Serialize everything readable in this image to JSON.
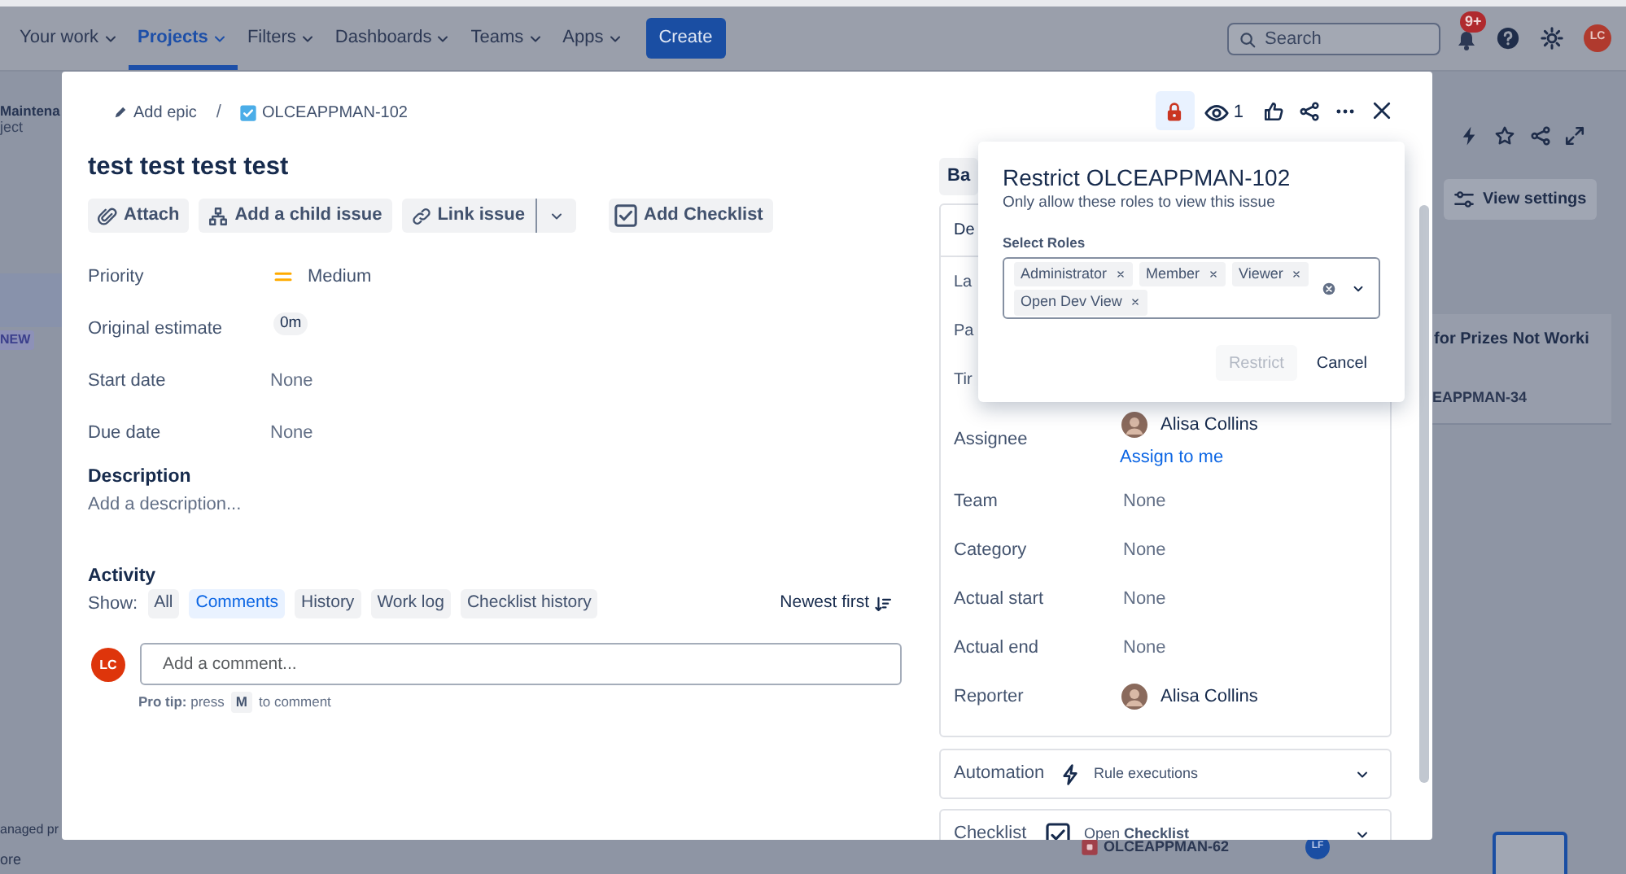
{
  "nav": {
    "items": [
      {
        "label": "Your work",
        "selected": false
      },
      {
        "label": "Projects",
        "selected": true
      },
      {
        "label": "Filters",
        "selected": false
      },
      {
        "label": "Dashboards",
        "selected": false
      },
      {
        "label": "Teams",
        "selected": false
      },
      {
        "label": "Apps",
        "selected": false
      }
    ],
    "create": "Create",
    "search_placeholder": "Search",
    "notifications": "9+",
    "avatar": "LC"
  },
  "background": {
    "project_name": "Maintena",
    "project_type": "ject",
    "tag": "NEW",
    "sidebar_footer": [
      "anaged pr",
      "ore"
    ],
    "view_settings": "View settings",
    "card_title": "for Prizes Not Worki",
    "card_key": "EAPPMAN-34",
    "bottom_card_key": "OLCEAPPMAN-62",
    "bottom_card_avatar": "LF"
  },
  "issue": {
    "breadcrumb": {
      "epic": "Add epic",
      "separator": "/",
      "key": "OLCEAPPMAN-102"
    },
    "restricted": true,
    "watchers": "1",
    "title": "test test test test",
    "actions": [
      {
        "label": "Attach",
        "kind": "attach",
        "split": false
      },
      {
        "label": "Add a child issue",
        "kind": "child",
        "split": false
      },
      {
        "label": "Link issue",
        "kind": "link",
        "split": true
      },
      {
        "label": "Add Checklist",
        "kind": "checklist",
        "split": false
      }
    ],
    "fields": [
      {
        "label": "Priority",
        "value": "Medium",
        "kind": "priority"
      },
      {
        "label": "Original estimate",
        "value": "0m",
        "kind": "badge"
      },
      {
        "label": "Start date",
        "value": "None",
        "kind": "text"
      },
      {
        "label": "Due date",
        "value": "None",
        "kind": "text"
      }
    ],
    "description": {
      "heading": "Description",
      "placeholder": "Add a description..."
    },
    "activity": {
      "heading": "Activity",
      "show_label": "Show:",
      "filters": [
        {
          "label": "All",
          "selected": false
        },
        {
          "label": "Comments",
          "selected": true
        },
        {
          "label": "History",
          "selected": false
        },
        {
          "label": "Work log",
          "selected": false
        },
        {
          "label": "Checklist history",
          "selected": false
        }
      ],
      "sort": "Newest first",
      "avatar": "LC",
      "comment_placeholder": "Add a comment...",
      "tip": "**Pro tip:** press",
      "tip_key": "M",
      "tip_end": "to comment"
    },
    "side": {
      "button": "Ba",
      "header": "De",
      "fields": [
        {
          "label": "La",
          "kind": "partial"
        },
        {
          "label": "Pa",
          "kind": "partial"
        },
        {
          "label": "Tir",
          "kind": "partial"
        },
        {
          "label": "Assignee",
          "value": "Alisa Collins",
          "kind": "user",
          "link": "Assign to me"
        },
        {
          "label": "Team",
          "value": "None",
          "kind": "text"
        },
        {
          "label": "Category",
          "value": "None",
          "kind": "text"
        },
        {
          "label": "Actual start",
          "value": "None",
          "kind": "text"
        },
        {
          "label": "Actual end",
          "value": "None",
          "kind": "text"
        },
        {
          "label": "Reporter",
          "value": "Alisa Collins",
          "kind": "user"
        }
      ],
      "panels": [
        {
          "label": "Automation",
          "text": "Rule executions",
          "kind": "automation"
        },
        {
          "label": "Checklist",
          "text": "Open **Checklist**",
          "kind": "checklist"
        }
      ]
    }
  },
  "restrict_popover": {
    "title": "Restrict OLCEAPPMAN-102",
    "subtitle": "Only allow these roles to view this issue",
    "field_label": "Select Roles",
    "roles": [
      "Administrator",
      "Member",
      "Viewer",
      "Open Dev View"
    ],
    "buttons": [
      {
        "label": "Restrict",
        "kind": "primary",
        "disabled": true
      },
      {
        "label": "Cancel",
        "kind": "subtle",
        "disabled": false
      }
    ]
  }
}
